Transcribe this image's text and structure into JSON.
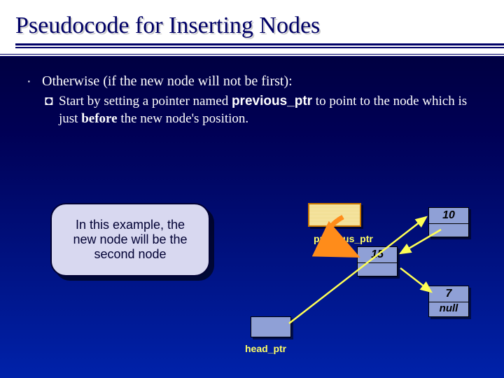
{
  "title": "Pseudocode for Inserting Nodes",
  "bullet": {
    "symbol": "·",
    "text_a": "Otherwise (if the new node will not be first):"
  },
  "subbullet": {
    "symbol": "◘",
    "text_a": "Start by setting a pointer named ",
    "code": "previous_ptr",
    "text_b": " to point to the node which is just ",
    "bold": "before",
    "text_c": " the new node's position."
  },
  "callout": "In this example, the new node will be the second node",
  "labels": {
    "previous_ptr": "previous_ptr",
    "head_ptr": "head_ptr"
  },
  "nodes": {
    "n1": "10",
    "n2": "15",
    "n3": "7",
    "null": "null"
  }
}
